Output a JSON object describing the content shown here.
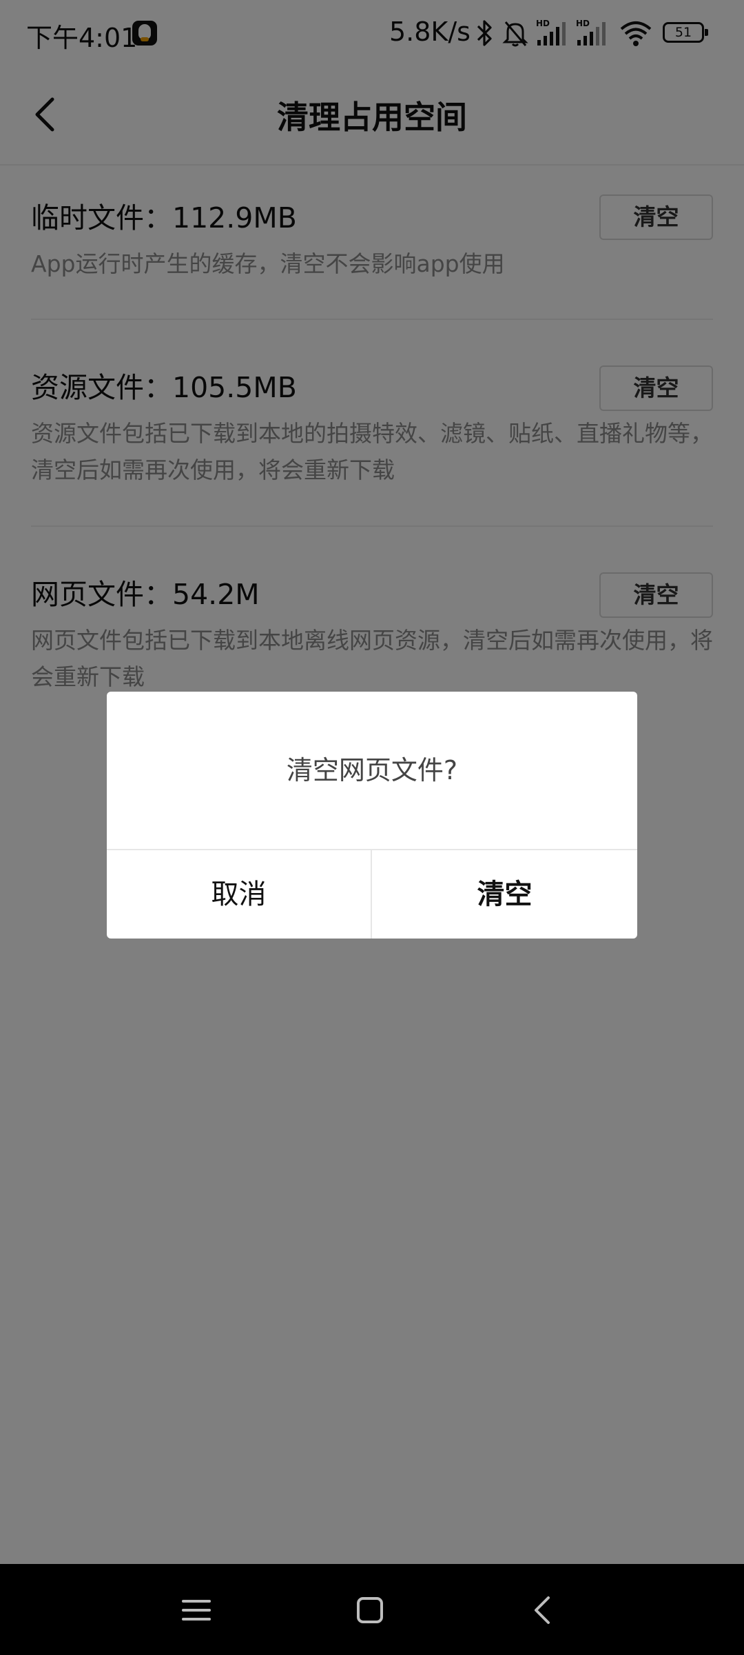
{
  "status_bar": {
    "time": "下午4:01",
    "net_speed": "5.8K/s",
    "battery": "51",
    "icons": [
      "qq-icon",
      "bluetooth-icon",
      "mute-icon",
      "signal-hd-icon",
      "signal-hd-icon",
      "wifi-icon",
      "battery-icon"
    ]
  },
  "header": {
    "title": "清理占用空间",
    "back_icon": "chevron-left-icon"
  },
  "items": [
    {
      "title": "临时文件：112.9MB",
      "desc": "App运行时产生的缓存，清空不会影响app使用",
      "button": "清空"
    },
    {
      "title": "资源文件：105.5MB",
      "desc": "资源文件包括已下载到本地的拍摄特效、滤镜、贴纸、直播礼物等，清空后如需再次使用，将会重新下载",
      "button": "清空"
    },
    {
      "title": "网页文件：54.2M",
      "desc": "网页文件包括已下载到本地离线网页资源，清空后如需再次使用，将会重新下载",
      "button": "清空"
    }
  ],
  "dialog": {
    "message": "清空网页文件?",
    "cancel": "取消",
    "confirm": "清空"
  },
  "nav_bar": {
    "icons": [
      "menu-icon",
      "home-icon",
      "back-icon"
    ]
  },
  "colors": {
    "overlay": "#00000080",
    "dialog_bg": "#ffffff",
    "nav_bg": "#000000"
  }
}
